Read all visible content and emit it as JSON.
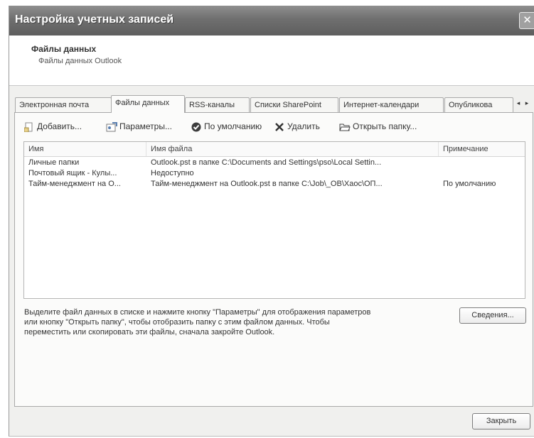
{
  "window": {
    "title": "Настройка учетных записей",
    "close_glyph": "✕"
  },
  "header": {
    "title": "Файлы данных",
    "subtitle": "Файлы данных Outlook"
  },
  "tabs": [
    {
      "label": "Электронная почта",
      "active": false
    },
    {
      "label": "Файлы данных",
      "active": true
    },
    {
      "label": "RSS-каналы",
      "active": false
    },
    {
      "label": "Списки SharePoint",
      "active": false
    },
    {
      "label": "Интернет-календари",
      "active": false
    },
    {
      "label": "Опубликова",
      "active": false
    }
  ],
  "tab_scroll": {
    "left": "◂",
    "right": "▸"
  },
  "toolbar": {
    "add": {
      "label": "Добавить...",
      "icon": "add-file-icon"
    },
    "settings": {
      "label": "Параметры...",
      "icon": "settings-icon"
    },
    "default": {
      "label": "По умолчанию",
      "icon": "check-circle-icon"
    },
    "delete": {
      "label": "Удалить",
      "icon": "delete-x-icon"
    },
    "open_folder": {
      "label": "Открыть папку...",
      "icon": "open-folder-icon"
    }
  },
  "list": {
    "columns": [
      "Имя",
      "Имя файла",
      "Примечание"
    ],
    "rows": [
      {
        "name": "Личные папки",
        "file": "Outlook.pst в папке C:\\Documents and Settings\\pso\\Local Settin...",
        "note": ""
      },
      {
        "name": "Почтовый ящик - Кулы...",
        "file": "Недоступно",
        "note": ""
      },
      {
        "name": "Тайм-менеджмент на О...",
        "file": "Тайм-менеджмент на Outlook.pst в папке C:\\Job\\_OB\\Хаос\\ОП...",
        "note": "По умолчанию"
      }
    ]
  },
  "info": {
    "line1": "Выделите файл данных в списке и нажмите кнопку \"Параметры\" для отображения параметров",
    "line2": "или кнопку \"Открыть папку\", чтобы отобразить папку с этим файлом данных. Чтобы",
    "line3": "переместить или скопировать эти файлы, сначала закройте Outlook."
  },
  "buttons": {
    "details": "Сведения...",
    "close": "Закрыть"
  }
}
